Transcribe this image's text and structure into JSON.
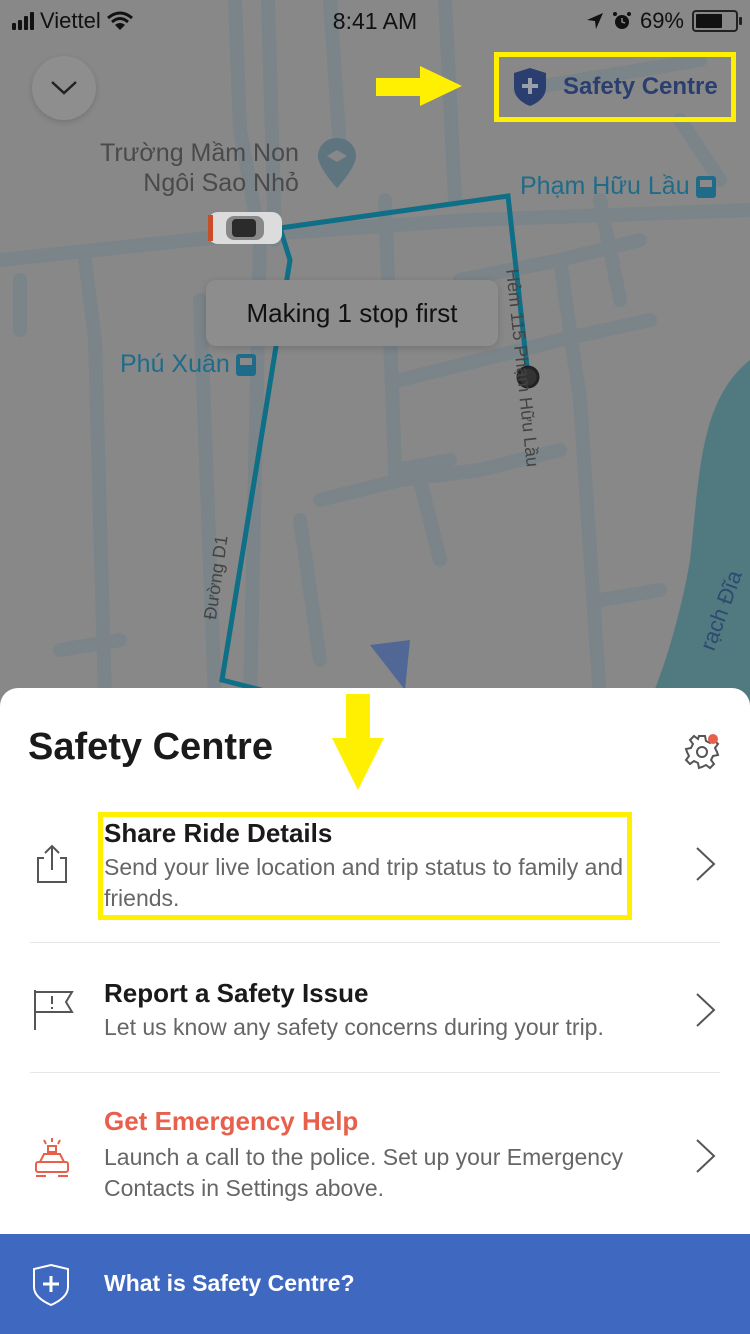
{
  "status_bar": {
    "carrier": "Viettel",
    "time": "8:41 AM",
    "battery_percent": "69%"
  },
  "map": {
    "collapse_icon": "chevron-down-icon",
    "safety_chip": {
      "icon": "shield-plus-icon",
      "label": "Safety Centre"
    },
    "poi": {
      "name_line1": "Trường Mầm Non",
      "name_line2": "Ngôi Sao Nhỏ",
      "icon": "school-pin-icon"
    },
    "bus_stops": [
      {
        "name": "Phạm Hữu Lầu",
        "icon": "bus-stop-icon"
      },
      {
        "name": "Phú Xuân",
        "icon": "bus-stop-icon"
      }
    ],
    "streets": [
      {
        "name": "Hẻm 115 Phạm Hữu Lầu"
      },
      {
        "name": "Đường D1"
      }
    ],
    "river": "rạch Đĩa",
    "stop_bubble": "Making 1 stop first",
    "route_color": "#0e6f87"
  },
  "sheet": {
    "title": "Safety Centre",
    "settings_icon": "gear-icon",
    "settings_badge_color": "#e8604c",
    "items": [
      {
        "icon": "share-icon",
        "title": "Share Ride Details",
        "description": "Send your live location and trip status to family and friends."
      },
      {
        "icon": "flag-icon",
        "title": "Report a Safety Issue",
        "description": "Let us know any safety concerns during your trip."
      },
      {
        "icon": "police-car-icon",
        "title": "Get Emergency Help",
        "description": "Launch a call to the police. Set up your Emergency Contacts in Settings above.",
        "accent": "#e8604c"
      }
    ]
  },
  "footer": {
    "icon": "shield-plus-icon",
    "label": "What is Safety Centre?",
    "background": "#3f68c1"
  },
  "annotations": {
    "highlight_color": "#ffef00"
  }
}
